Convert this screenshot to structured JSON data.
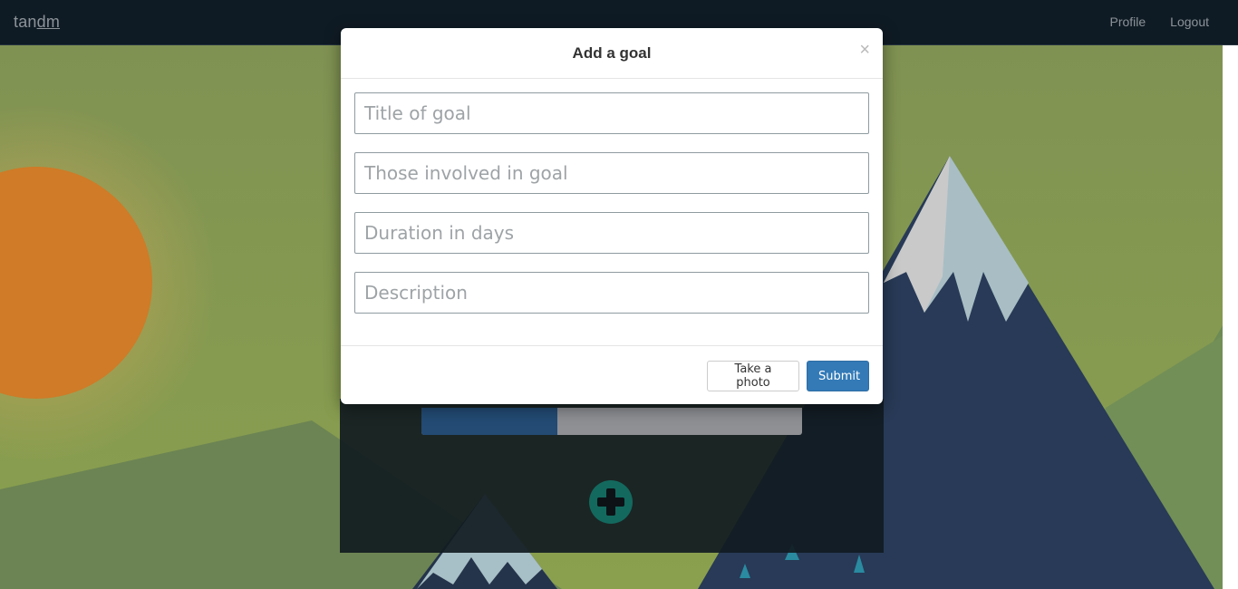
{
  "navbar": {
    "brand_prefix": "tan",
    "brand_suffix": "dm",
    "links": [
      "Profile",
      "Logout"
    ]
  },
  "background": {
    "sky_top": "#7c9151",
    "sky_bottom": "#8aa34f",
    "sun_color": "#d07a26",
    "mountain_dark": "#283a57",
    "mountain_snow": "#b7c6c9",
    "hill_color": "#6b8453"
  },
  "goal_card": {
    "progress_fraction": 0.357
  },
  "modal": {
    "title": "Add a goal",
    "close_glyph": "×",
    "fields": {
      "title_placeholder": "Title of goal",
      "involved_placeholder": "Those involved in goal",
      "duration_placeholder": "Duration in days",
      "description_placeholder": "Description"
    },
    "buttons": {
      "photo": "Take a photo",
      "submit": "Submit"
    }
  }
}
